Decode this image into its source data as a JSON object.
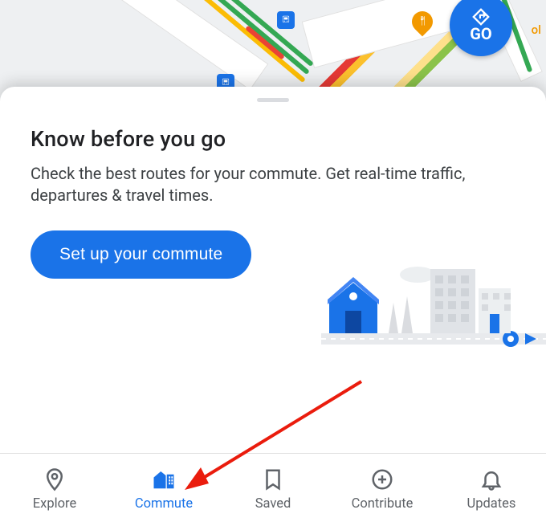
{
  "map": {
    "go_label": "GO",
    "ol_label": "ol"
  },
  "card": {
    "title": "Know before you go",
    "description": "Check the best routes for your commute. Get real-time traffic, departures & travel times.",
    "cta_label": "Set up your commute"
  },
  "nav": {
    "items": [
      {
        "id": "explore",
        "label": "Explore",
        "active": false
      },
      {
        "id": "commute",
        "label": "Commute",
        "active": true
      },
      {
        "id": "saved",
        "label": "Saved",
        "active": false
      },
      {
        "id": "contribute",
        "label": "Contribute",
        "active": false
      },
      {
        "id": "updates",
        "label": "Updates",
        "active": false
      }
    ]
  },
  "colors": {
    "accent": "#1a73e8",
    "text_primary": "#202124",
    "text_secondary": "#5f6368",
    "annotation_arrow": "#ea1c0d"
  }
}
